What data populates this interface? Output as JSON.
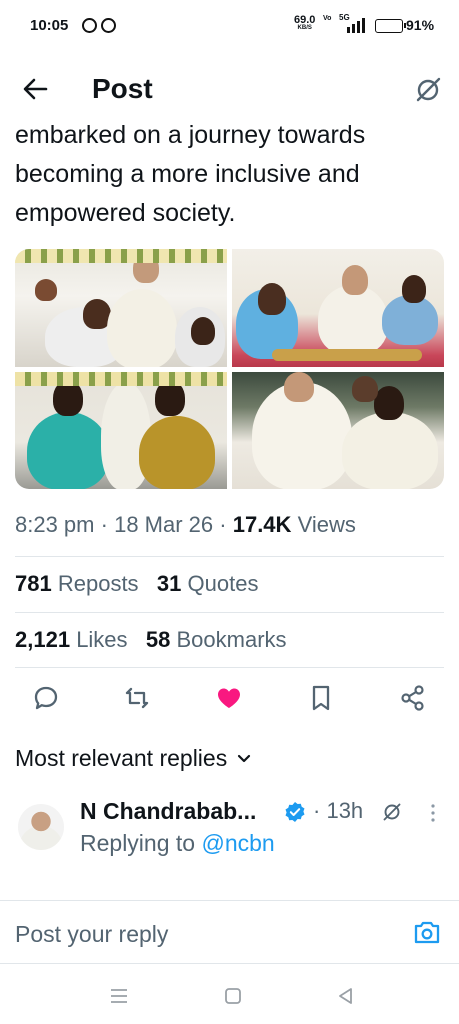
{
  "status_bar": {
    "time": "10:05",
    "speed_value": "69.0",
    "speed_unit": "KB/S",
    "network": "5G",
    "volte": "Vo",
    "battery_level": 0.91,
    "battery_text": "91%",
    "battery_color": "#f2b705"
  },
  "header": {
    "title": "Post",
    "back_icon": "arrow-left-icon",
    "grok_icon": "grok-icon"
  },
  "tweet": {
    "text": "embarked on a journey towards becoming a more inclusive and empowered society.",
    "time": "8:23 pm",
    "date": "18 Mar 26",
    "views_count": "17.4K",
    "views_label": "Views",
    "reposts_count": "781",
    "reposts_label": "Reposts",
    "quotes_count": "31",
    "quotes_label": "Quotes",
    "likes_count": "2,121",
    "likes_label": "Likes",
    "bookmarks_count": "58",
    "bookmarks_label": "Bookmarks",
    "liked": true
  },
  "actions": [
    "reply-icon",
    "repost-icon",
    "like-icon",
    "bookmark-icon",
    "share-icon"
  ],
  "replies": {
    "sort_label": "Most relevant replies",
    "items": [
      {
        "name": "N Chandrabab...",
        "verified": true,
        "time": "13h",
        "replying_prefix": "Replying to",
        "replying_handle": "@ncbn"
      }
    ]
  },
  "compose": {
    "placeholder": "Post your reply"
  },
  "colors": {
    "accent": "#1d9bf0",
    "like": "#f91880",
    "secondary_text": "#536471",
    "primary_text": "#0f1419"
  }
}
